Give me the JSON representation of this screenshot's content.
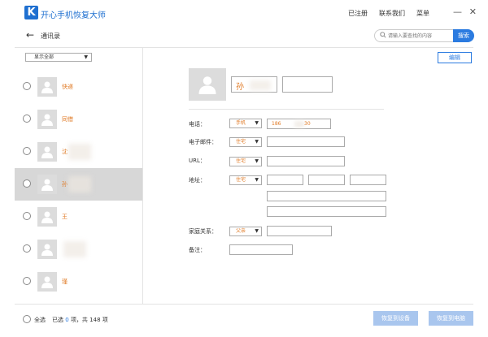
{
  "colors": {
    "accent": "#2b7be0",
    "name_highlight": "#e07a25",
    "selected_row": "#d7d7d7"
  },
  "titlebar": {
    "logo_letter": "K",
    "app_title": "开心手机恢复大师",
    "registered": "已注册",
    "contact_us": "联系我们",
    "menu": "菜单",
    "minimize": "—",
    "close": "✕"
  },
  "nav": {
    "back": "←",
    "title": "通讯录",
    "search_placeholder": "请输入要查找的内容",
    "search_button": "搜索"
  },
  "filter": {
    "selected": "显示全部"
  },
  "contacts": [
    {
      "name": "快递"
    },
    {
      "name": "同借"
    },
    {
      "name": "沈"
    },
    {
      "name": "孙"
    },
    {
      "name": "王"
    },
    {
      "name": ""
    },
    {
      "name": "瑾"
    }
  ],
  "detail": {
    "edit_button": "编辑",
    "name_first": "孙",
    "phone_label": "电话：",
    "phone_type": "手机",
    "phone_value": "186",
    "phone_tail": "30",
    "email_label": "电子邮件：",
    "email_type": "住宅",
    "url_label": "URL：",
    "url_type": "住宅",
    "address_label": "地址：",
    "address_type": "住宅",
    "relation_label": "家庭关系：",
    "relation_type": "父亲",
    "note_label": "备注："
  },
  "bottom": {
    "select_all": "全选",
    "selected_prefix": "已选",
    "selected_count": "0",
    "total_text": "项，共 148 项",
    "restore_device": "恢复到设备",
    "restore_pc": "恢复到电脑"
  }
}
